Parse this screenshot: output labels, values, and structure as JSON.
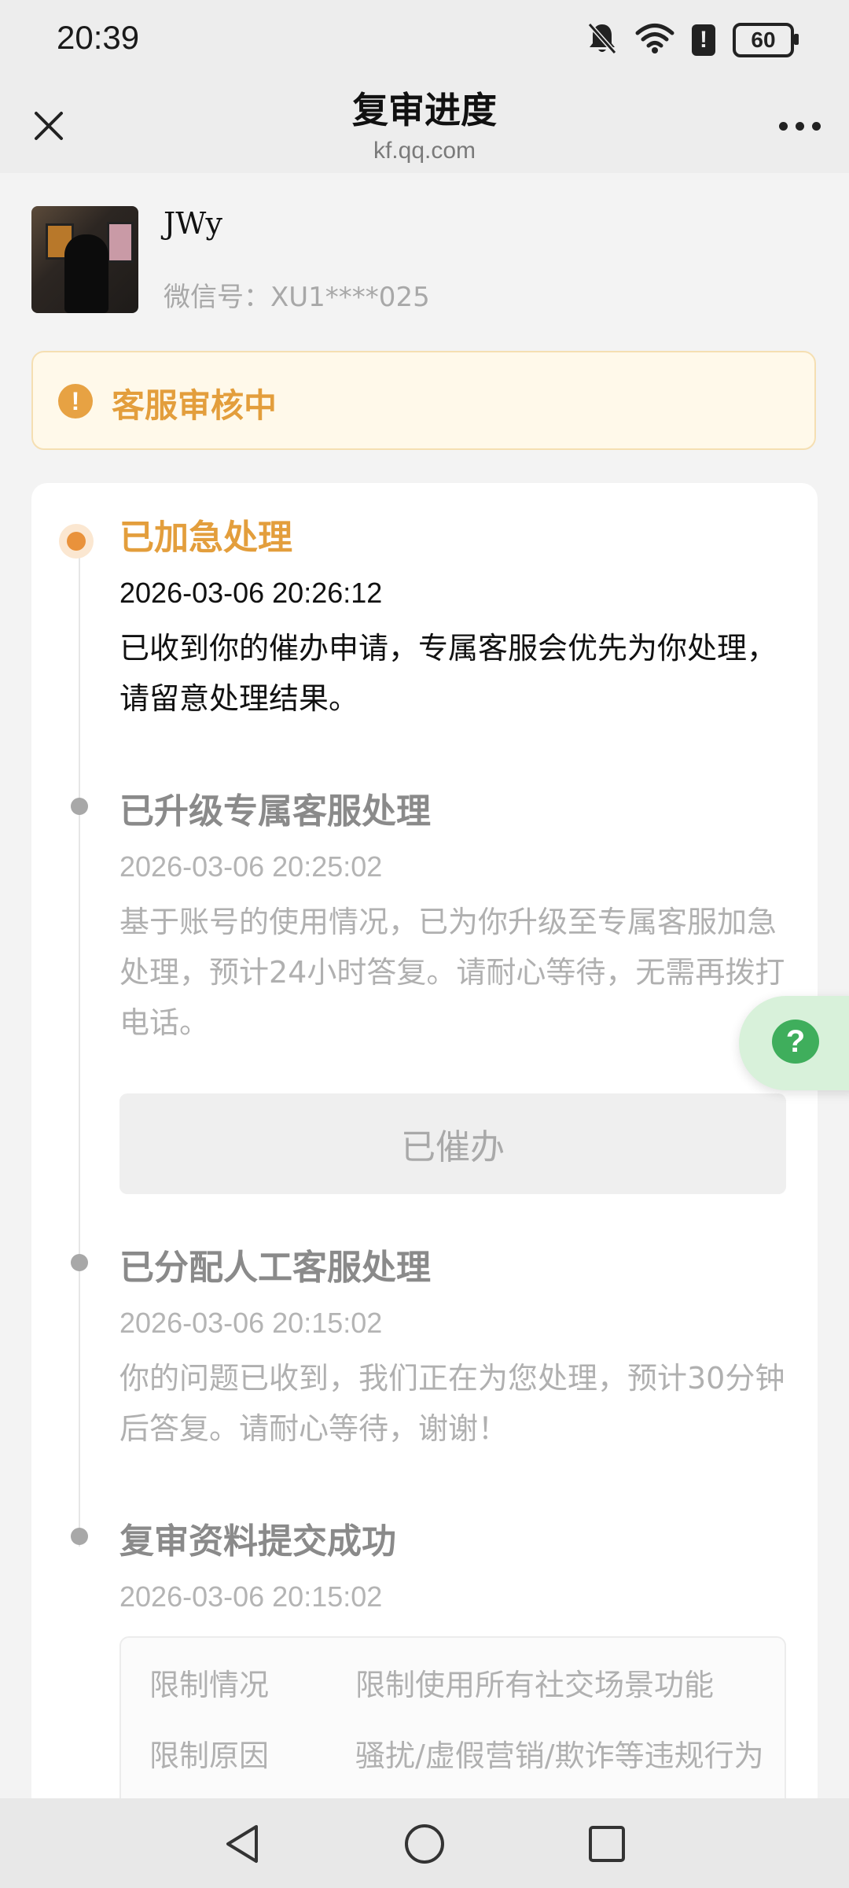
{
  "status_bar": {
    "time": "20:39",
    "battery": "60",
    "icons": [
      "bell-muted-icon",
      "wifi-icon",
      "alert-icon",
      "battery-icon"
    ]
  },
  "nav": {
    "title": "复审进度",
    "subtitle": "kf.qq.com",
    "icons": [
      "close-icon",
      "more-icon"
    ]
  },
  "profile": {
    "name": "JWy",
    "wechat_id": "微信号：XU1****025"
  },
  "banner": {
    "icon": "exclamation-icon",
    "text": "客服审核中",
    "color": "#e39e3c"
  },
  "timeline": [
    {
      "title": "已加急处理",
      "time": "2026-03-06 20:26:12",
      "desc": "已收到你的催办申请，专属客服会优先为你处理，请留意处理结果。",
      "state": "active"
    },
    {
      "title": "已升级专属客服处理",
      "time": "2026-03-06 20:25:02",
      "desc": "基于账号的使用情况，已为你升级至专属客服加急处理，预计24小时答复。请耐心等待，无需再拨打电话。",
      "button": "已催办",
      "state": "done"
    },
    {
      "title": "已分配人工客服处理",
      "time": "2026-03-06 20:15:02",
      "desc": "你的问题已收到，我们正在为您处理，预计30分钟后答复。请耐心等待，谢谢！",
      "state": "done"
    },
    {
      "title": "复审资料提交成功",
      "time": "2026-03-06 20:15:02",
      "details": [
        {
          "key": "限制情况",
          "value": "限制使用所有社交场景功能"
        },
        {
          "key": "限制原因",
          "value": "骚扰/虚假营销/欺诈等违规行为"
        }
      ],
      "state": "done"
    }
  ],
  "help": {
    "icon": "help-question-icon",
    "color": "#3fae5c"
  },
  "system_nav": [
    "back-icon",
    "home-icon",
    "recents-icon"
  ],
  "colors": {
    "accent": "#e39e3c",
    "active_dot": "#e9923b"
  }
}
